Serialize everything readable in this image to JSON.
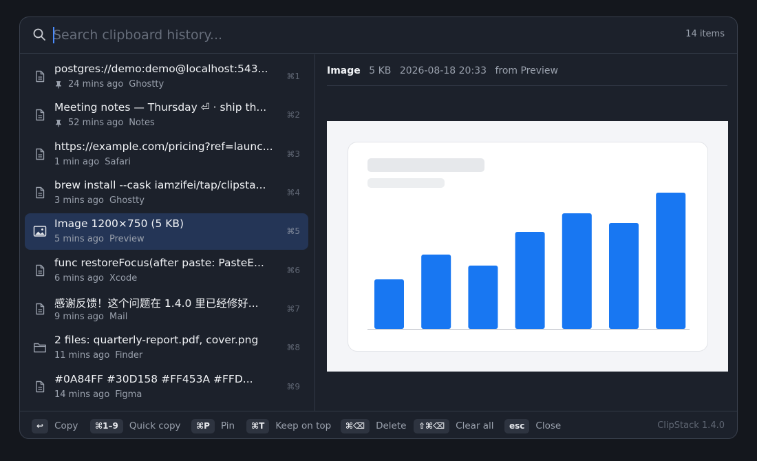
{
  "search": {
    "placeholder": "Search clipboard history...",
    "count": "14 items"
  },
  "items": [
    {
      "title": "postgres://demo:demo@localhost:543...",
      "time": "24 mins ago",
      "app": "Ghostty",
      "shortcut": "⌘1",
      "icon": "document-icon",
      "pinned": true
    },
    {
      "title": "Meeting notes — Thursday ⏎ · ship th...",
      "time": "52 mins ago",
      "app": "Notes",
      "shortcut": "⌘2",
      "icon": "document-icon",
      "pinned": true
    },
    {
      "title": "https://example.com/pricing?ref=launc...",
      "time": "1 min ago",
      "app": "Safari",
      "shortcut": "⌘3",
      "icon": "document-icon",
      "pinned": false
    },
    {
      "title": "brew install --cask iamzifei/tap/clipsta...",
      "time": "3 mins ago",
      "app": "Ghostty",
      "shortcut": "⌘4",
      "icon": "document-icon",
      "pinned": false
    },
    {
      "title": "Image 1200×750 (5 KB)",
      "time": "5 mins ago",
      "app": "Preview",
      "shortcut": "⌘5",
      "icon": "image-icon",
      "pinned": false,
      "selected": true
    },
    {
      "title": "func restoreFocus(after paste: PasteE...",
      "time": "6 mins ago",
      "app": "Xcode",
      "shortcut": "⌘6",
      "icon": "document-icon",
      "pinned": false
    },
    {
      "title": "感谢反馈！这个问题在 1.4.0 里已经修好...",
      "time": "9 mins ago",
      "app": "Mail",
      "shortcut": "⌘7",
      "icon": "document-icon",
      "pinned": false
    },
    {
      "title": "2 files: quarterly-report.pdf, cover.png",
      "time": "11 mins ago",
      "app": "Finder",
      "shortcut": "⌘8",
      "icon": "folder-icon",
      "pinned": false
    },
    {
      "title": "#0A84FF   #30D158   #FF453A   #FFD...",
      "time": "14 mins ago",
      "app": "Figma",
      "shortcut": "⌘9",
      "icon": "document-icon",
      "pinned": false
    }
  ],
  "preview": {
    "kind": "Image",
    "size": "5 KB",
    "timestamp": "2026-08-18 20:33",
    "source": "from Preview",
    "bar_values": [
      72,
      108,
      92,
      141,
      168,
      154,
      198
    ],
    "bar_color": "#1877f2"
  },
  "footer": {
    "hints": [
      {
        "key": "↩",
        "label": "Copy"
      },
      {
        "key": "⌘1–9",
        "label": "Quick copy"
      },
      {
        "key": "⌘P",
        "label": "Pin"
      },
      {
        "key": "⌘T",
        "label": "Keep on top"
      },
      {
        "key": "⌘⌫",
        "label": "Delete"
      },
      {
        "key": "⇧⌘⌫",
        "label": "Clear all"
      },
      {
        "key": "esc",
        "label": "Close"
      }
    ],
    "version": "ClipStack 1.4.0"
  },
  "colors": {
    "accent": "#4a8cff",
    "selected_row": "#243556",
    "panel": "#1c212b"
  }
}
